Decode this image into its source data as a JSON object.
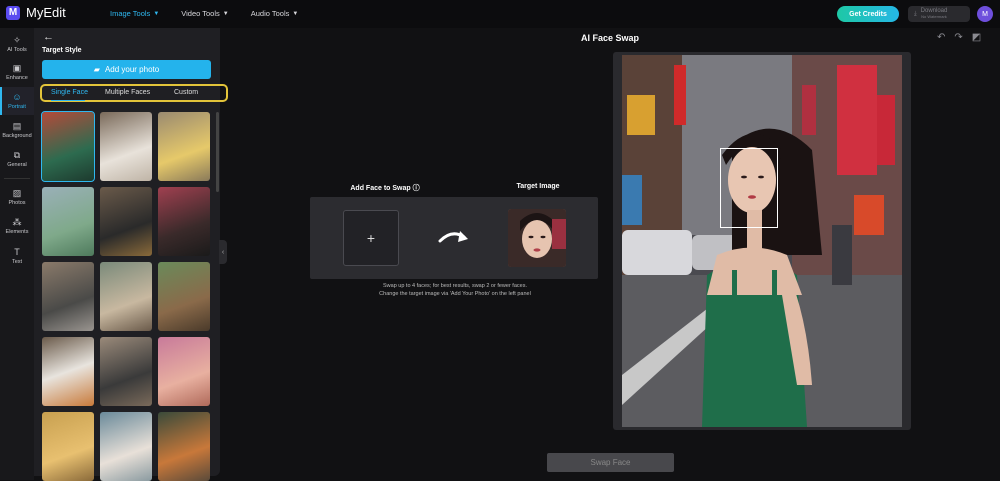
{
  "app": {
    "name": "MyEdit",
    "logo_letter": "M"
  },
  "nav": [
    {
      "label": "Image Tools",
      "active": true
    },
    {
      "label": "Video Tools",
      "active": false
    },
    {
      "label": "Audio Tools",
      "active": false
    }
  ],
  "header": {
    "credits_label": "Get Credits",
    "download_label": "Download",
    "download_sub": "No Watermark",
    "avatar_initial": "M"
  },
  "rail": [
    {
      "label": "AI Tools",
      "icon": "wand-icon"
    },
    {
      "label": "Enhance",
      "icon": "image-enhance-icon"
    },
    {
      "label": "Portrait",
      "icon": "portrait-icon",
      "active": true
    },
    {
      "label": "Background",
      "icon": "background-icon"
    },
    {
      "label": "General",
      "icon": "general-icon"
    },
    {
      "label": "Photos",
      "icon": "photos-icon"
    },
    {
      "label": "Elements",
      "icon": "elements-icon"
    },
    {
      "label": "Text",
      "icon": "text-icon"
    }
  ],
  "panel": {
    "title": "Target Style",
    "add_photo_label": "Add your photo",
    "tabs": [
      {
        "label": "Single Face",
        "active": true
      },
      {
        "label": "Multiple Faces",
        "active": false
      },
      {
        "label": "Custom",
        "active": false
      }
    ]
  },
  "main": {
    "title": "AI Face Swap",
    "add_face_label": "Add Face to Swap",
    "target_label": "Target Image",
    "hint_line1": "Swap up to 4 faces; for best results, swap 2 or fewer faces.",
    "hint_line2": "Change the target image via 'Add Your Photo' on the left panel",
    "swap_button": "Swap Face"
  },
  "colors": {
    "accent": "#2fb8f0",
    "highlight": "#e3c43a",
    "credits": "#1ec8a5"
  }
}
